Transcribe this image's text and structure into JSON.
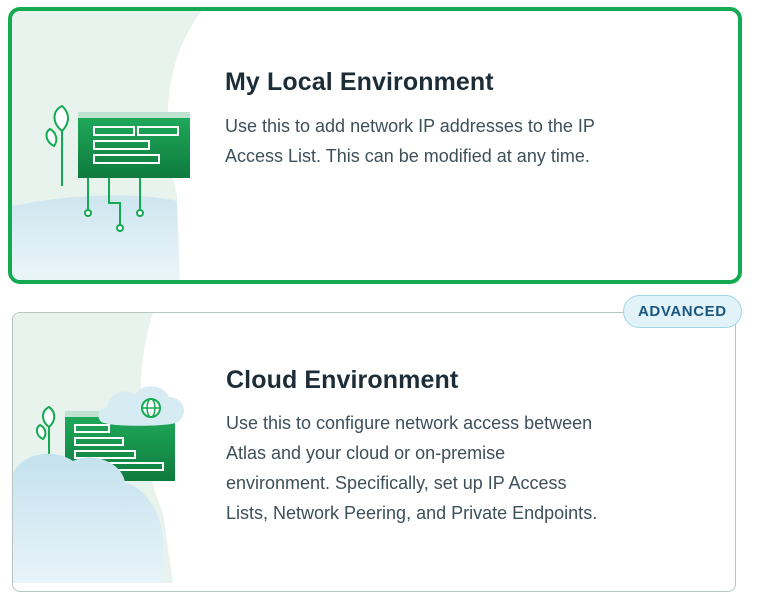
{
  "options": [
    {
      "title": "My Local Environment",
      "description_lines": [
        "Use this to add network IP addresses to the IP",
        "Access List. This can be modified at any time."
      ],
      "selected": true
    },
    {
      "title": "Cloud Environment",
      "badge": "ADVANCED",
      "description_lines": [
        "Use this to configure network access between",
        "Atlas and your cloud or on-premise",
        "environment. Specifically, set up IP Access",
        "Lists, Network Peering, and Private Endpoints."
      ],
      "selected": false
    }
  ],
  "colors": {
    "selected_border": "#13aa52",
    "card_border": "#b8c4c2",
    "badge_bg": "#e1f3f8",
    "badge_text": "#1a567e",
    "illustration_green": "#13aa52"
  }
}
